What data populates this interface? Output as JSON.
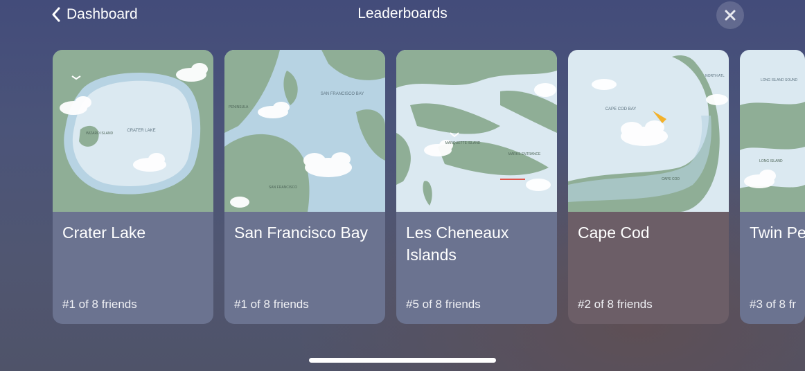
{
  "header": {
    "back_label": "Dashboard",
    "title": "Leaderboards"
  },
  "colors": {
    "land": "#8fae96",
    "water_light": "#dbe9f1",
    "water_shallow": "#b7d3e3",
    "card_default": "#6b7390",
    "card_highlight": "#6c5e67"
  },
  "cards": [
    {
      "name": "Crater Lake",
      "rank": "#1 of 8 friends",
      "map_labels": [
        "CRATER LAKE",
        "WIZARD ISLAND"
      ]
    },
    {
      "name": "San Francisco Bay",
      "rank": "#1 of 8 friends",
      "map_labels": [
        "SAN FRANCISCO BAY",
        "PENINSULA",
        "SAN FRANCISCO"
      ]
    },
    {
      "name": "Les Cheneaux Islands",
      "rank": "#5 of 8 friends",
      "map_labels": [
        "MARQUETTE ISLAND",
        "MARKS ENTRANCE"
      ]
    },
    {
      "name": "Cape Cod",
      "rank": "#2 of 8 friends",
      "map_labels": [
        "CAPE COD BAY",
        "NORTH ATL",
        "CAPE COD"
      ]
    },
    {
      "name": "Twin Pe",
      "rank": "#3 of 8 fr",
      "map_labels": [
        "LONG ISLAND",
        "LONG ISLAND SOUND"
      ]
    }
  ]
}
